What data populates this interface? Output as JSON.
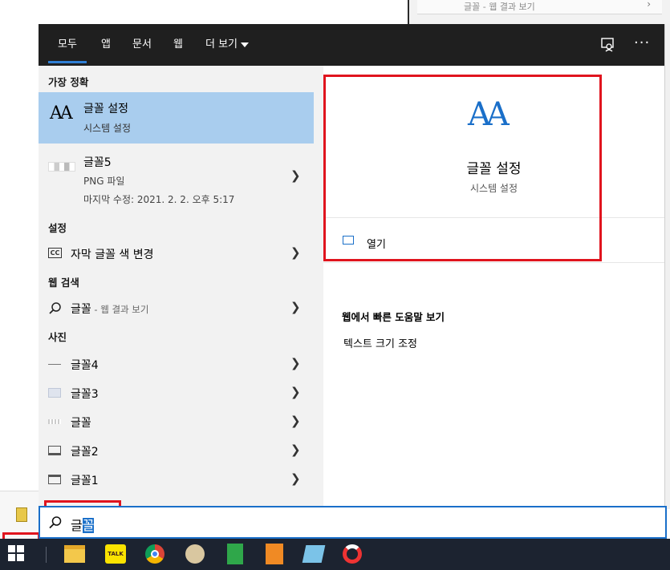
{
  "background": {
    "top_search_text": "글꼴 - 웹 결과 보기"
  },
  "menu": {
    "tabs": [
      {
        "label": "모두",
        "active": true
      },
      {
        "label": "앱"
      },
      {
        "label": "문서"
      },
      {
        "label": "웹"
      },
      {
        "label": "더 보기"
      }
    ],
    "more_options": "···"
  },
  "left": {
    "best_match_header": "가장 정확",
    "best_match": {
      "title": "글꼴 설정",
      "subtitle": "시스템 설정",
      "icon": "font-aa-icon"
    },
    "file": {
      "title": "글꼴5",
      "type": "PNG 파일",
      "modified": "마지막 수정: 2021. 2. 2. 오후 5:17"
    },
    "settings_header": "설정",
    "settings_item": "자막 글꼴 색 변경",
    "web_header": "웹 검색",
    "web_item_query": "글꼴",
    "web_item_suffix": " - 웹 결과 보기",
    "photos_header": "사진",
    "photos": [
      "글꼴4",
      "글꼴3",
      "글꼴",
      "글꼴2",
      "글꼴1"
    ]
  },
  "right": {
    "title": "글꼴 설정",
    "subtitle": "시스템 설정",
    "open_label": "열기",
    "web_help_header": "웹에서 빠른 도움말 보기",
    "web_help_link": "텍스트 크기 조정"
  },
  "search": {
    "typed": "글",
    "selected": "꼴"
  },
  "colors": {
    "accent": "#1a6fc9",
    "highlight": "#e0141e",
    "best_match_bg": "#a9cdee"
  }
}
